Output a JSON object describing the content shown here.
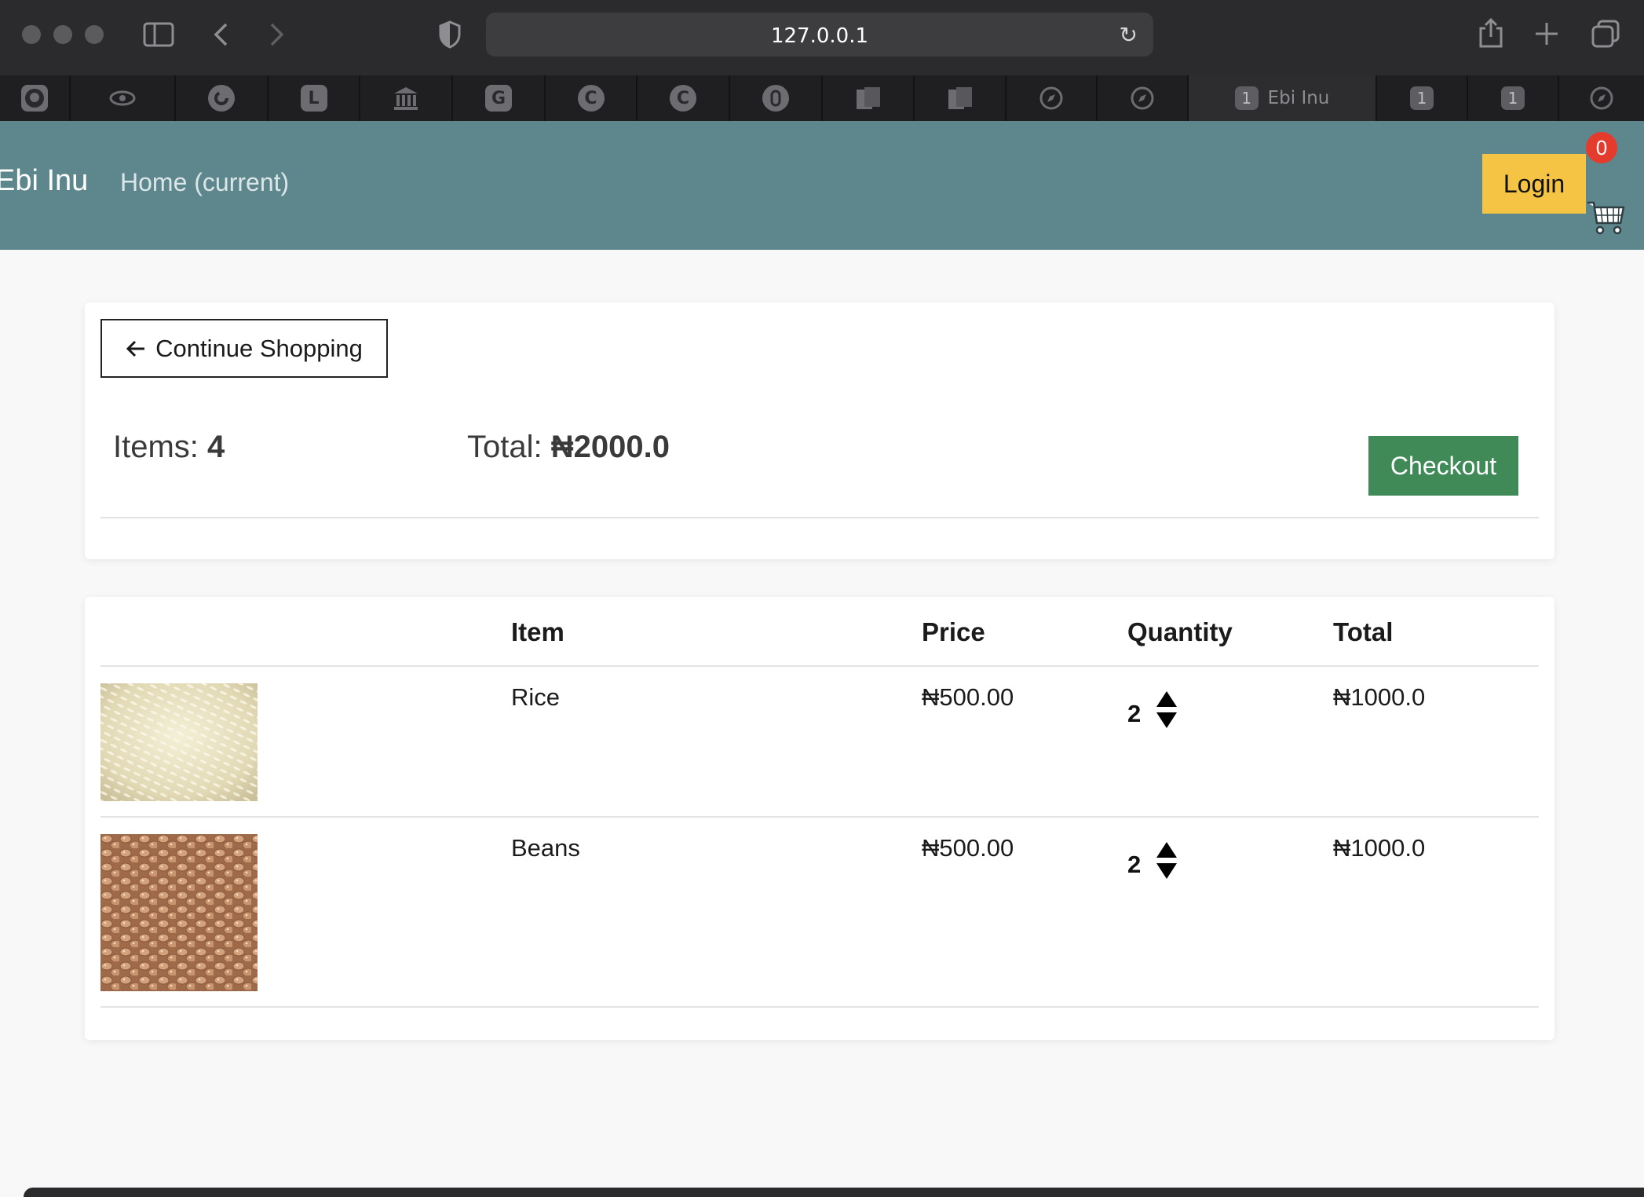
{
  "browser": {
    "url": "127.0.0.1",
    "tabs": [
      {
        "icon": "github-icon",
        "label": ""
      },
      {
        "icon": "eye-icon",
        "label": ""
      },
      {
        "icon": "swirl-icon",
        "label": ""
      },
      {
        "icon": "letter-l-icon",
        "glyph": "L",
        "label": ""
      },
      {
        "icon": "bank-icon",
        "label": ""
      },
      {
        "icon": "letter-g-icon",
        "glyph": "G",
        "label": ""
      },
      {
        "icon": "letter-c-icon",
        "glyph": "C",
        "label": ""
      },
      {
        "icon": "letter-c-icon",
        "glyph": "C",
        "label": ""
      },
      {
        "icon": "clip-icon",
        "label": ""
      },
      {
        "icon": "documents-icon",
        "label": ""
      },
      {
        "icon": "documents-icon",
        "label": ""
      },
      {
        "icon": "compass-icon",
        "label": ""
      },
      {
        "icon": "compass-icon",
        "label": ""
      },
      {
        "icon": "number-tab-icon",
        "glyph": "1",
        "label": "Ebi Inu",
        "active": true
      },
      {
        "icon": "number-tab-icon",
        "glyph": "1",
        "label": ""
      },
      {
        "icon": "number-tab-icon",
        "glyph": "1",
        "label": ""
      },
      {
        "icon": "compass-icon",
        "label": ""
      }
    ]
  },
  "nav": {
    "brand": "Ebi Inu",
    "home_link": "Home (current)",
    "login_label": "Login",
    "cart_count": "0"
  },
  "summary": {
    "continue_label": "Continue Shopping",
    "items_label": "Items:",
    "items_count": "4",
    "total_label": "Total:",
    "total_value": "₦2000.0",
    "checkout_label": "Checkout"
  },
  "cart_table": {
    "headers": {
      "item": "Item",
      "price": "Price",
      "quantity": "Quantity",
      "total": "Total"
    },
    "rows": [
      {
        "name": "Rice",
        "price": "₦500.00",
        "quantity": "2",
        "total": "₦1000.0",
        "image": "rice-photo"
      },
      {
        "name": "Beans",
        "price": "₦500.00",
        "quantity": "2",
        "total": "₦1000.0",
        "image": "beans-photo"
      }
    ]
  },
  "colors": {
    "navbar": "#5e878d",
    "login_button": "#f6c444",
    "checkout_button": "#3f8a57",
    "cart_badge": "#e53b2c"
  }
}
